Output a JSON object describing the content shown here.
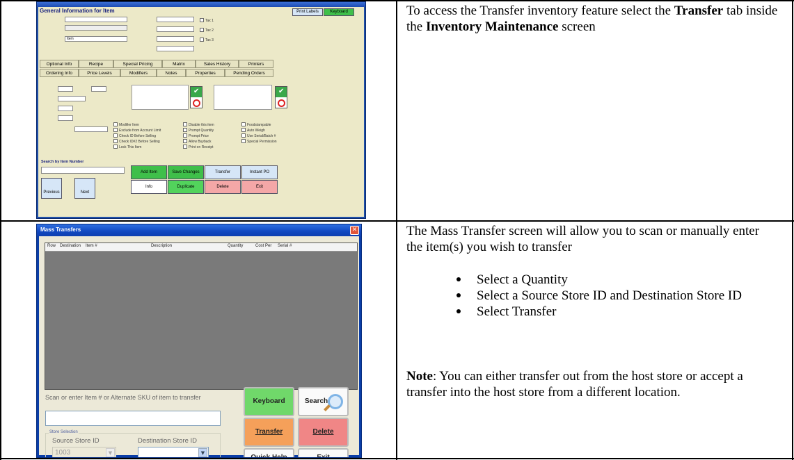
{
  "row1": {
    "text_pre": "To access the Transfer inventory feature select the ",
    "text_bold1": "Transfer",
    "text_mid": " tab inside the ",
    "text_bold2": "Inventory Maintenance",
    "text_post": " screen",
    "screenshot": {
      "header": "General Information for Item",
      "print_labels": "Print Labels",
      "keyboard": "Keyboard",
      "tabs_row1": [
        "Optional Info",
        "Recipe",
        "Special Pricing",
        "Matrix",
        "Sales History",
        "Printers"
      ],
      "tabs_row2": [
        "Ordering Info",
        "Price Levels",
        "Modifiers",
        "Notes",
        "Properties",
        "Pending Orders"
      ],
      "search_label": "Search by Item Number",
      "buttons": {
        "add_item": "Add Item",
        "save_changes": "Save Changes",
        "transfer": "Transfer",
        "instant_po": "Instant PO",
        "duplicate": "Duplicate",
        "delete": "Delete",
        "exit": "Exit",
        "previous": "Previous",
        "next": "Next",
        "info": "Info"
      },
      "description_value": "Item"
    }
  },
  "row2": {
    "intro": "The Mass Transfer screen will allow you to scan or manually enter the item(s) you wish to transfer",
    "bullets": [
      "Select a Quantity",
      "Select a Source Store ID and Destination Store ID",
      "Select Transfer"
    ],
    "note_label": "Note",
    "note_text": ":  You can either transfer out from the host store or accept a transfer into the host store from a different location.",
    "screenshot": {
      "title": "Mass Transfers",
      "columns": [
        "Row",
        "Destination",
        "Item #",
        "Description",
        "Quantity",
        "Cost Per",
        "Serial #"
      ],
      "scan_label": "Scan or enter Item # or Alternate SKU of item to transfer",
      "store_selection": "Store Selection",
      "source_label": "Source Store ID",
      "source_value": "1003",
      "destination_label": "Destination Store ID",
      "buttons": {
        "keyboard": "Keyboard",
        "search": "Search",
        "transfer": "Transfer",
        "delete": "Delete",
        "quick_help": "Quick Help",
        "exit": "Exit"
      }
    }
  }
}
